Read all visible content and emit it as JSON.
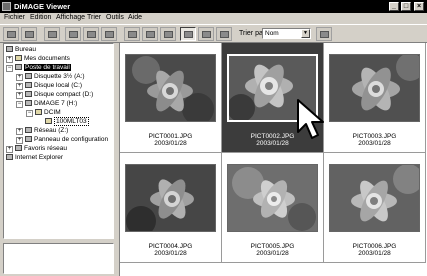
{
  "window": {
    "title": "DiMAGE Viewer",
    "buttons": [
      "_",
      "□",
      "×"
    ]
  },
  "menu": [
    "Fichier",
    "Edition",
    "Affichage",
    "Trier",
    "Outils",
    "Aide"
  ],
  "toolbar": {
    "sort_label": "Trier par :",
    "sort_value": "Nom",
    "sort_arrow": "▼"
  },
  "tree": [
    {
      "label": "Bureau",
      "state": "normal"
    },
    {
      "label": "Mes documents",
      "state": "normal"
    },
    {
      "label": "Poste de travail",
      "state": "selected"
    },
    {
      "label": "Disquette 3½ (A:)",
      "state": "normal"
    },
    {
      "label": "Disque local (C:)",
      "state": "normal"
    },
    {
      "label": "Disque compact (D:)",
      "state": "normal"
    },
    {
      "label": "DiMAGE 7 (H:)",
      "state": "normal"
    },
    {
      "label": "DCIM",
      "state": "normal"
    },
    {
      "label": "100MLT03",
      "state": "focused"
    },
    {
      "label": "Réseau (Z:)",
      "state": "normal"
    },
    {
      "label": "Panneau de configuration",
      "state": "normal"
    },
    {
      "label": "Favoris réseau",
      "state": "normal"
    },
    {
      "label": "Internet Explorer",
      "state": "normal"
    }
  ],
  "thumbnails": [
    {
      "name": "PICT0001.JPG",
      "date": "2003/01/28",
      "selected": false
    },
    {
      "name": "PICT0002.JPG",
      "date": "2003/01/28",
      "selected": true
    },
    {
      "name": "PICT0003.JPG",
      "date": "2003/01/28",
      "selected": false
    },
    {
      "name": "PICT0004.JPG",
      "date": "2003/01/28",
      "selected": false
    },
    {
      "name": "PICT0005.JPG",
      "date": "2003/01/28",
      "selected": false
    },
    {
      "name": "PICT0006.JPG",
      "date": "2003/01/28",
      "selected": false
    }
  ],
  "colors": {
    "titlebar": "#000000",
    "chrome": "#d4d0c8",
    "selected_cell": "#3c3c3c"
  }
}
